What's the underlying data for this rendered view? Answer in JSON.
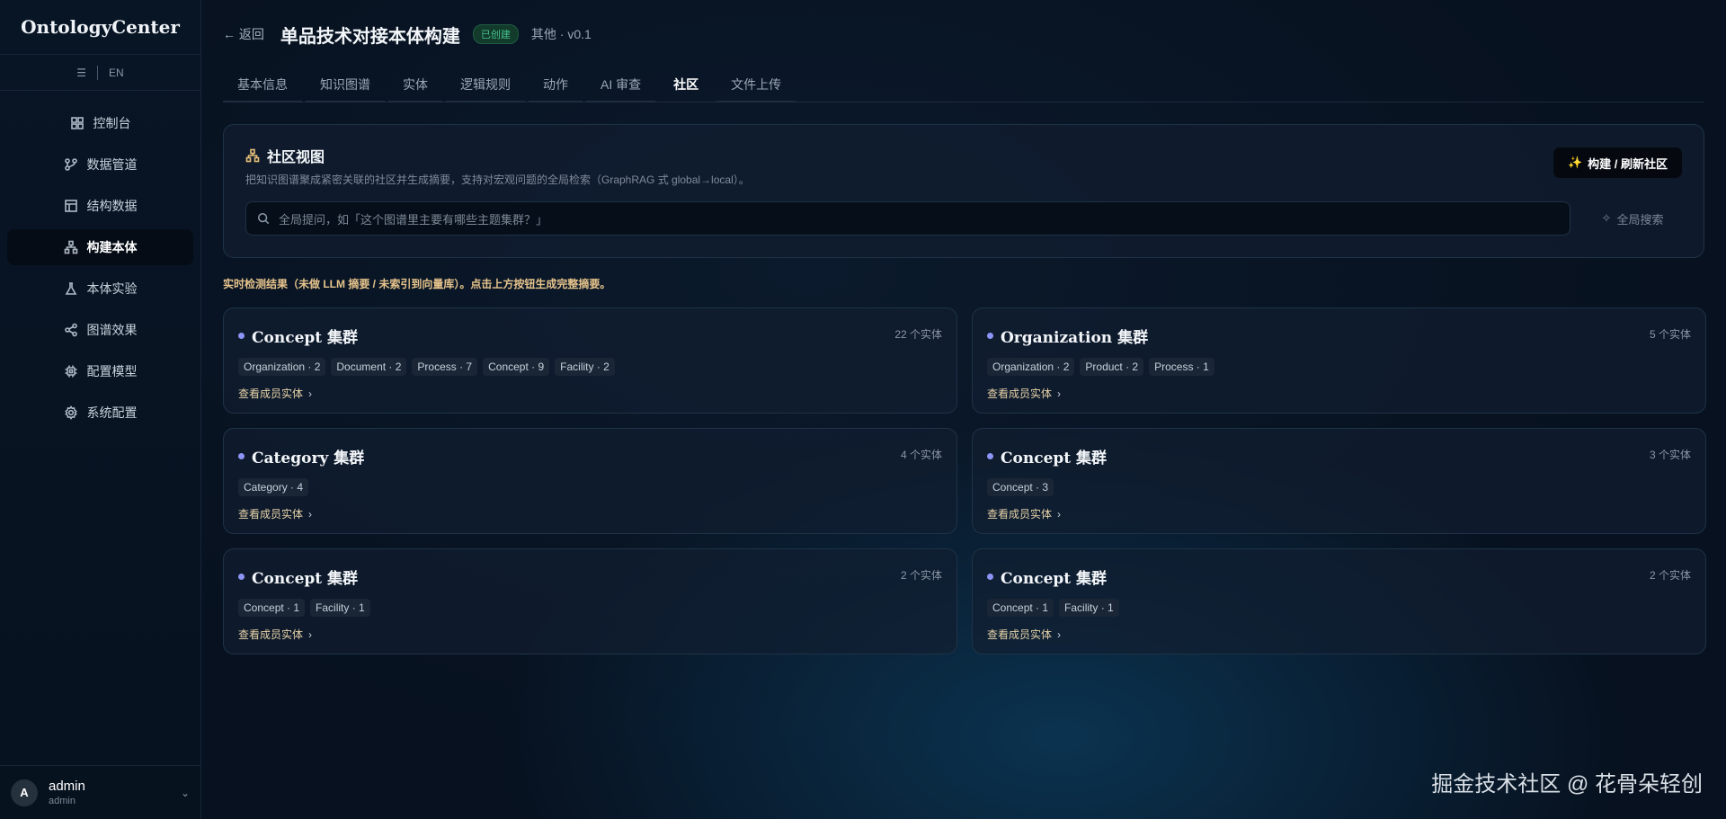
{
  "app": {
    "name": "OntologyCenter"
  },
  "sidebar": {
    "menu_icon": "menu-icon",
    "lang": "EN",
    "items": [
      {
        "label": "控制台",
        "icon": "dashboard-icon",
        "active": false
      },
      {
        "label": "数据管道",
        "icon": "pipeline-icon",
        "active": false
      },
      {
        "label": "结构数据",
        "icon": "table-icon",
        "active": false
      },
      {
        "label": "构建本体",
        "icon": "ontology-icon",
        "active": true
      },
      {
        "label": "本体实验",
        "icon": "flask-icon",
        "active": false
      },
      {
        "label": "图谱效果",
        "icon": "share-graph-icon",
        "active": false
      },
      {
        "label": "配置模型",
        "icon": "chip-icon",
        "active": false
      },
      {
        "label": "系统配置",
        "icon": "gear-icon",
        "active": false
      }
    ],
    "user": {
      "initial": "A",
      "name": "admin",
      "role": "admin"
    }
  },
  "header": {
    "back": "← 返回",
    "title": "单品技术对接本体构建",
    "status": "已创建",
    "meta": "其他 · v0.1"
  },
  "tabs": [
    "基本信息",
    "知识图谱",
    "实体",
    "逻辑规则",
    "动作",
    "AI 审查",
    "社区",
    "文件上传"
  ],
  "active_tab": "社区",
  "community": {
    "title": "社区视图",
    "description": "把知识图谱聚成紧密关联的社区并生成摘要，支持对宏观问题的全局检索（GraphRAG 式 global→local）。",
    "build_button": "构建 / 刷新社区",
    "search_placeholder": "全局提问，如「这个图谱里主要有哪些主题集群？」",
    "search_button": "全局搜索",
    "notice": "实时检测结果（未做 LLM 摘要 / 未索引到向量库）。点击上方按钮生成完整摘要。",
    "view_members": "查看成员实体",
    "clusters": [
      {
        "title": "Concept 集群",
        "count": "22 个实体",
        "tags": [
          "Organization · 2",
          "Document · 2",
          "Process · 7",
          "Concept · 9",
          "Facility · 2"
        ]
      },
      {
        "title": "Organization 集群",
        "count": "5 个实体",
        "tags": [
          "Organization · 2",
          "Product · 2",
          "Process · 1"
        ]
      },
      {
        "title": "Category 集群",
        "count": "4 个实体",
        "tags": [
          "Category · 4"
        ]
      },
      {
        "title": "Concept 集群",
        "count": "3 个实体",
        "tags": [
          "Concept · 3"
        ]
      },
      {
        "title": "Concept 集群",
        "count": "2 个实体",
        "tags": [
          "Concept · 1",
          "Facility · 1"
        ]
      },
      {
        "title": "Concept 集群",
        "count": "2 个实体",
        "tags": [
          "Concept · 1",
          "Facility · 1"
        ]
      }
    ]
  },
  "watermark": "掘金技术社区 @ 花骨朵轻创",
  "colors": {
    "accent_dot": "#8c95f5",
    "link": "#e6d2a8",
    "notice": "#e7c48c",
    "badge": "#47c08a"
  }
}
